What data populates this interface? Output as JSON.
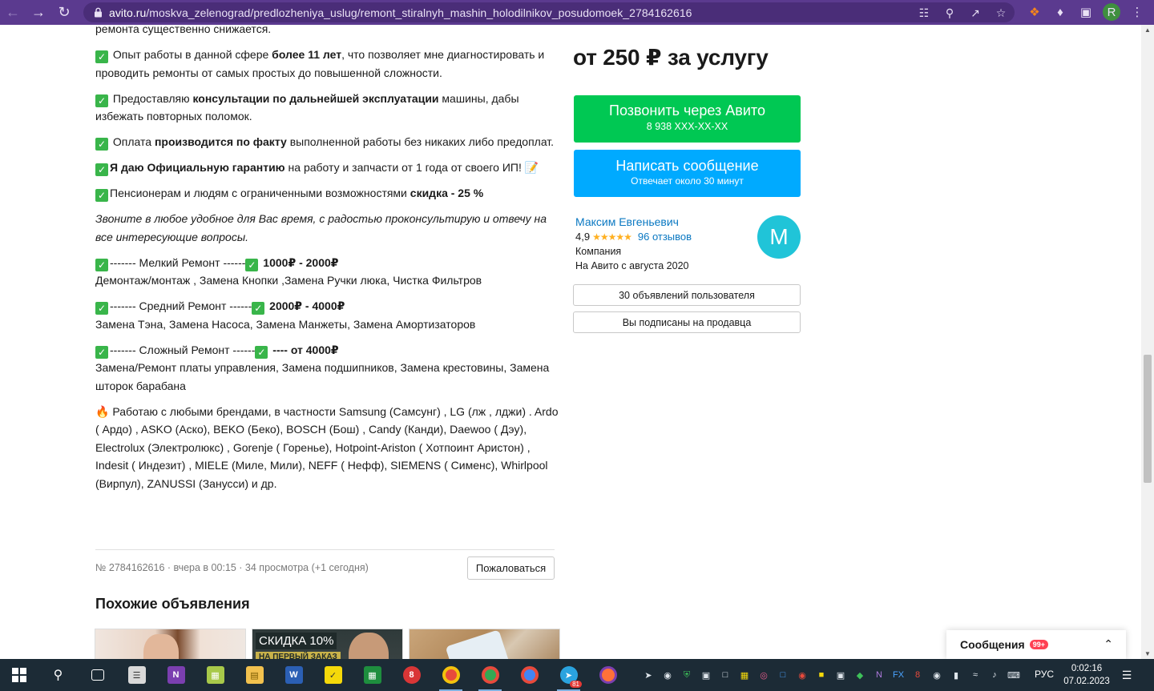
{
  "browser": {
    "url_host": "avito.ru",
    "url_path": "/moskva_zelenograd/predlozheniya_uslug/remont_stiralnyh_mashin_holodilnikov_posudomoek_2784162616",
    "profile_initial": "R"
  },
  "description": {
    "p0": "ремонта существенно снижается.",
    "p1_a": " Опыт работы в данной сфере ",
    "p1_b": "более 11 лет",
    "p1_c": ", что позволяет мне диагностировать и проводить ремонты от самых простых до повышенной сложности.",
    "p2_a": " Предоставляю ",
    "p2_b": "консультации по дальнейшей эксплуатации",
    "p2_c": " машины, дабы избежать повторных поломок.",
    "p3_a": " Оплата ",
    "p3_b": "производится по факту",
    "p3_c": " выполненной работы без никаких либо предоплат.",
    "p4_b": "Я даю Официальную гарантию",
    "p4_c": " на работу и запчасти от 1 года от своего ИП! ",
    "p5_a": "Пенсионерам и людям с ограниченными возможностями ",
    "p5_b": "скидка - 25 %",
    "p6": "Звоните в любое удобное для Вас время, с радостью проконсультирую и отвечу на все интересующие вопросы.",
    "p7_a": "------- Мелкий Ремонт ------",
    "p7_b": " 1000₽ - 2000₽",
    "p7_c": "Демонтаж/монтаж , Замена Кнопки ,Замена Ручки люка, Чистка Фильтров",
    "p8_a": "------- Средний Ремонт ------",
    "p8_b": " 2000₽ - 4000₽",
    "p8_c": "Замена Тэна, Замена Насоса, Замена Манжеты, Замена Амортизаторов",
    "p9_a": "------- Сложный Ремонт ------",
    "p9_b": " ---- от 4000₽",
    "p9_c": "Замена/Ремонт платы управления, Замена подшипников, Замена крестовины, Замена шторок барабана",
    "p10": " Работаю с любыми брендами, в частности Samsung (Самсунг) , LG (лж , лджи) . Ardo ( Ардо) , ASKO (Аско), BEKO (Беко), BOSCH (Бош) , Candy (Канди), Daewoo ( Дэу), Electrolux (Электролюкс) , Gorenje ( Горенье), Hotpoint-Ariston ( Хотпоинт Аристон) , Indesit ( Индезит) , MIELE (Миле, Мили), NEFF ( Нефф), SIEMENS ( Сименс), Whirlpool (Вирпул), ZANUSSI (Занусси) и др."
  },
  "meta": {
    "text": "№ 2784162616 · вчера в 00:15 · 34 просмотра (+1 сегодня)",
    "complain_label": "Пожаловаться"
  },
  "similar": {
    "title": "Похожие объявления",
    "badge": "СКИДКА 10%",
    "badge_sub": "НА ПЕРВЫЙ ЗАКАЗ"
  },
  "sidebar": {
    "price": "от 250 ₽ за услугу",
    "call_label": "Позвонить через Авито",
    "call_phone": "8 938 XXX-XX-XX",
    "msg_label": "Написать сообщение",
    "msg_sub": "Отвечает около 30 минут",
    "seller_name": "Максим Евгеньевич",
    "rating": "4,9",
    "stars": "★★★★★",
    "reviews": "96 отзывов",
    "seller_type": "Компания",
    "seller_since": "На Авито с августа 2020",
    "avatar_letter": "М",
    "ads_button": "30 объявлений пользователя",
    "subscribed_button": "Вы подписаны на продавца"
  },
  "messages_widget": {
    "title": "Сообщения",
    "badge": "99+"
  },
  "taskbar": {
    "language": "РУС",
    "time": "0:02:16",
    "date": "07.02.2023",
    "telegram_badge": "81"
  },
  "colors": {
    "browser_frame": "#5b3a8f",
    "call_button": "#00c853",
    "message_button": "#00aaff",
    "link": "#0a78c2",
    "avatar": "#20c4d8"
  }
}
